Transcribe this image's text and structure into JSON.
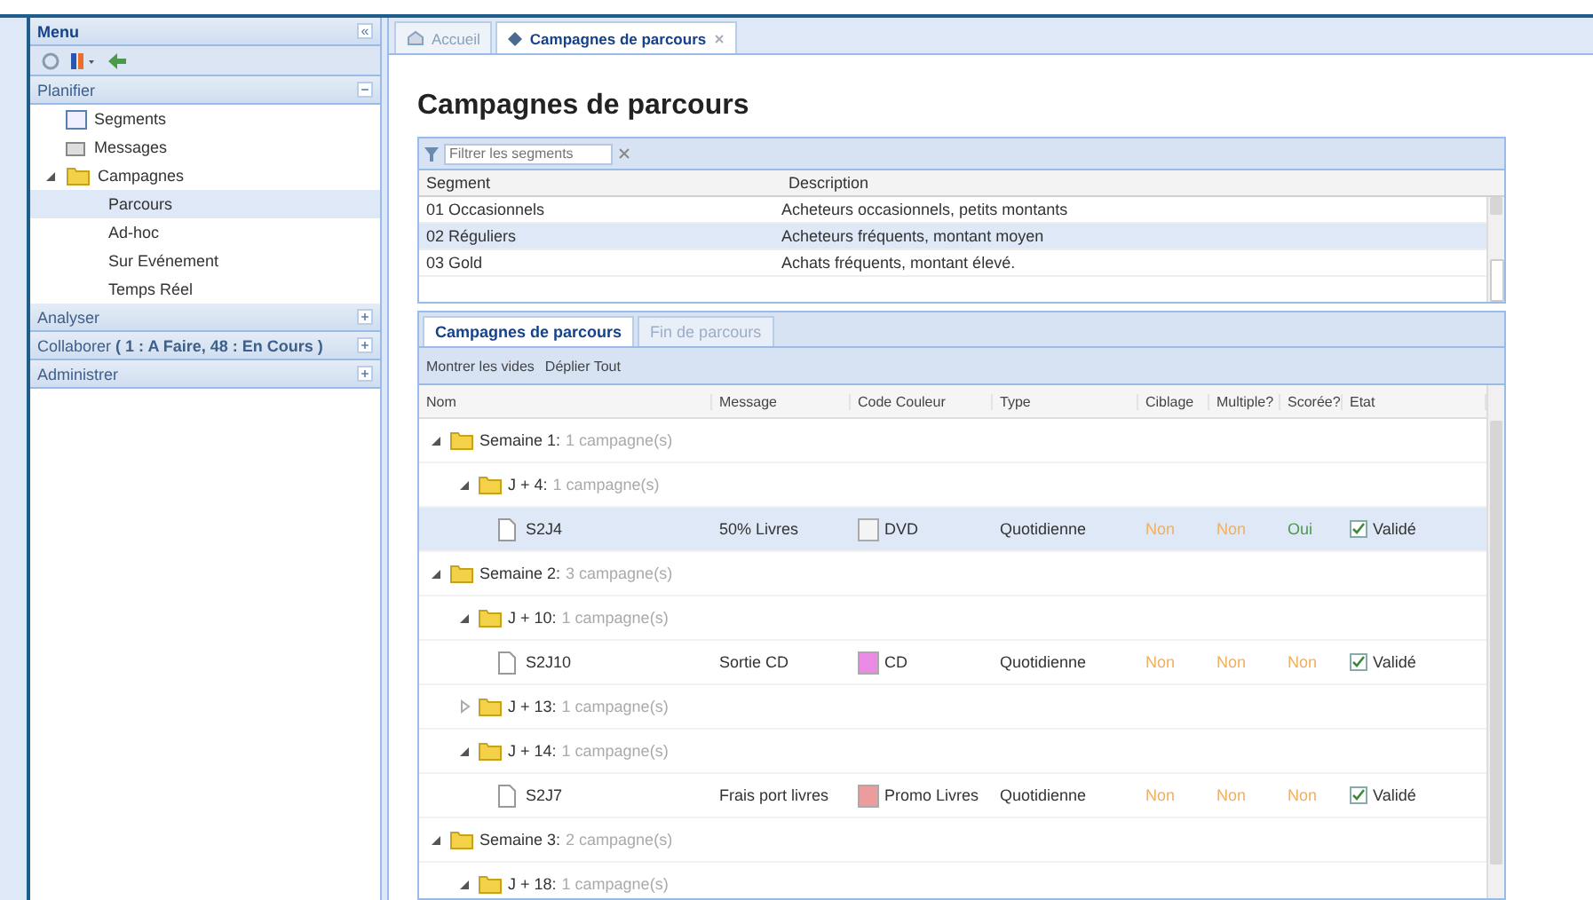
{
  "sidebar": {
    "title": "Menu",
    "collapse_button": "«",
    "sections": [
      {
        "title": "Planifier",
        "expanded": true,
        "items": [
          {
            "label": "Segments",
            "kind": "segments",
            "expanded": false,
            "selected": false
          },
          {
            "label": "Messages",
            "kind": "messages",
            "expanded": false,
            "selected": false
          },
          {
            "label": "Campagnes",
            "kind": "folder",
            "expanded": true,
            "selected": false,
            "children": [
              {
                "label": "Parcours",
                "selected": true
              },
              {
                "label": "Ad-hoc",
                "selected": false
              },
              {
                "label": "Sur Evénement",
                "selected": false
              },
              {
                "label": "Temps Réel",
                "selected": false
              }
            ]
          }
        ]
      },
      {
        "title": "Analyser",
        "expanded": false
      },
      {
        "title": "Collaborer",
        "extra": "( 1 : A Faire, 48 : En Cours )",
        "expanded": false
      },
      {
        "title": "Administrer",
        "expanded": false
      }
    ]
  },
  "tabs": [
    {
      "label": "Accueil",
      "selected": false,
      "closable": false
    },
    {
      "label": "Campagnes de parcours",
      "selected": true,
      "closable": true
    }
  ],
  "page_title": "Campagnes de parcours",
  "segments": {
    "filter": {
      "placeholder": "Filtrer les segments"
    },
    "columns": [
      "Segment",
      "Description"
    ],
    "rows": [
      {
        "segment": "01 Occasionnels",
        "description": "Acheteurs occasionnels, petits montants",
        "selected": false
      },
      {
        "segment": "02 Réguliers",
        "description": "Acheteurs fréquents, montant moyen",
        "selected": true
      },
      {
        "segment": "03 Gold",
        "description": "Achats fréquents, montant élevé.",
        "selected": false
      }
    ]
  },
  "sub_tabs": [
    {
      "label": "Campagnes de parcours",
      "selected": true
    },
    {
      "label": "Fin de parcours",
      "selected": false
    }
  ],
  "toolbar": [
    "Montrer les vides",
    "Déplier Tout"
  ],
  "campaigns": {
    "columns": [
      "Nom",
      "Message",
      "Code Couleur",
      "Type",
      "Ciblage",
      "Multiple?",
      "Scorée?",
      "Etat"
    ],
    "rows": [
      {
        "kind": "group",
        "label": "Semaine 1:",
        "count": "1 campagne(s)",
        "expanded": true,
        "children": [
          {
            "kind": "group",
            "label": "J + 4:",
            "count": "1 campagne(s)",
            "expanded": true,
            "children": [
              {
                "kind": "campaign",
                "name": "S2J4",
                "message": "50% Livres",
                "code": "DVD",
                "color": "#f4f4f4",
                "type": "Quotidienne",
                "flags": [
                  {
                    "text": "Non",
                    "on": false
                  },
                  {
                    "text": "Non",
                    "on": false
                  },
                  {
                    "text": "Oui",
                    "on": true
                  }
                ],
                "status": "Validé",
                "checked": true,
                "selected": true
              }
            ]
          }
        ]
      },
      {
        "kind": "group",
        "label": "Semaine 2:",
        "count": "3 campagne(s)",
        "expanded": true,
        "children": [
          {
            "kind": "group",
            "label": "J + 10:",
            "count": "1 campagne(s)",
            "expanded": true,
            "children": [
              {
                "kind": "campaign",
                "name": "S2J10",
                "message": "Sortie CD",
                "code": "CD",
                "color": "#e98ae4",
                "type": "Quotidienne",
                "flags": [
                  {
                    "text": "Non",
                    "on": false
                  },
                  {
                    "text": "Non",
                    "on": false
                  },
                  {
                    "text": "Non",
                    "on": false
                  }
                ],
                "status": "Validé",
                "checked": true,
                "selected": false
              }
            ]
          },
          {
            "kind": "group",
            "label": "J + 13:",
            "count": "1 campagne(s)",
            "expanded": false
          },
          {
            "kind": "group",
            "label": "J + 14:",
            "count": "1 campagne(s)",
            "expanded": true,
            "children": [
              {
                "kind": "campaign",
                "name": "S2J7",
                "message": "Frais port livres",
                "code": "Promo Livres",
                "color": "#eb9c9c",
                "type": "Quotidienne",
                "flags": [
                  {
                    "text": "Non",
                    "on": false
                  },
                  {
                    "text": "Non",
                    "on": false
                  },
                  {
                    "text": "Non",
                    "on": false
                  }
                ],
                "status": "Validé",
                "checked": true,
                "selected": false
              }
            ]
          }
        ]
      },
      {
        "kind": "group",
        "label": "Semaine 3:",
        "count": "2 campagne(s)",
        "expanded": true,
        "children": [
          {
            "kind": "group",
            "label": "J + 18:",
            "count": "1 campagne(s)",
            "expanded": true
          }
        ]
      }
    ]
  }
}
